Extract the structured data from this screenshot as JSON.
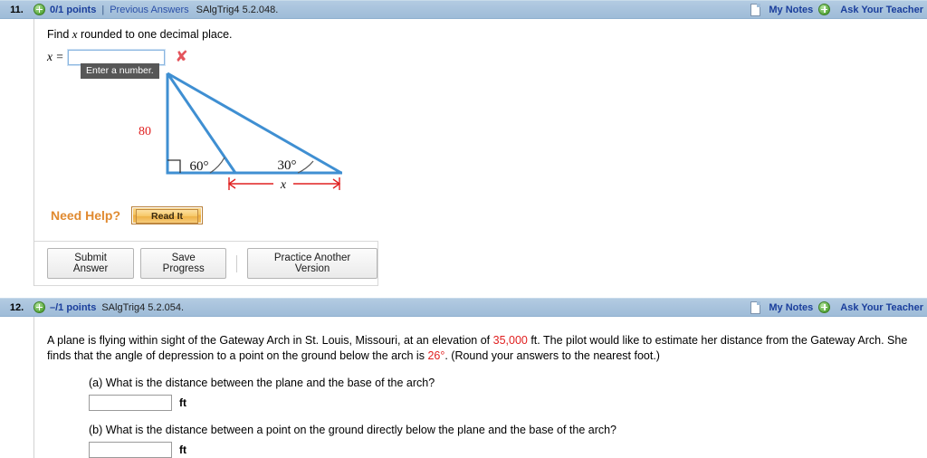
{
  "questions": [
    {
      "number": "11.",
      "points": "0/1 points",
      "separator": "|",
      "previous_answers": "Previous Answers",
      "code": "SAlgTrig4 5.2.048.",
      "my_notes": "My Notes",
      "ask_teacher": "Ask Your Teacher",
      "prompt_before": "Find ",
      "prompt_var": "x",
      "prompt_after": " rounded to one decimal place.",
      "answer_label": "x =",
      "answer_value": "",
      "tooltip": "Enter a number.",
      "wrong_mark": "✘",
      "need_help_label": "Need Help?",
      "read_it_label": "Read It",
      "buttons": {
        "submit": "Submit Answer",
        "save": "Save Progress",
        "practice": "Practice Another Version"
      },
      "diagram": {
        "side_label": "80",
        "angle_left": "60°",
        "angle_right": "30°",
        "dimension_label": "x",
        "stroke_color": "#3f8fd2",
        "accent_color": "#e02020"
      }
    },
    {
      "number": "12.",
      "points": "–/1 points",
      "code": "SAlgTrig4 5.2.054.",
      "my_notes": "My Notes",
      "ask_teacher": "Ask Your Teacher",
      "paragraph": {
        "part1": "A plane is flying within sight of the Gateway Arch in St. Louis, Missouri, at an elevation of ",
        "value1": "35,000",
        "part2": " ft. The pilot would like to estimate her distance from the Gateway Arch. She finds that the angle of depression to a point on the ground below the arch is ",
        "value2": "26°",
        "part3": ". (Round your answers to the nearest foot.)"
      },
      "subquestions": [
        {
          "label": "(a) What is the distance between the plane and the base of the arch?",
          "value": "",
          "unit": "ft"
        },
        {
          "label": "(b) What is the distance between a point on the ground directly below the plane and the base of the arch?",
          "value": "",
          "unit": "ft"
        }
      ]
    }
  ]
}
